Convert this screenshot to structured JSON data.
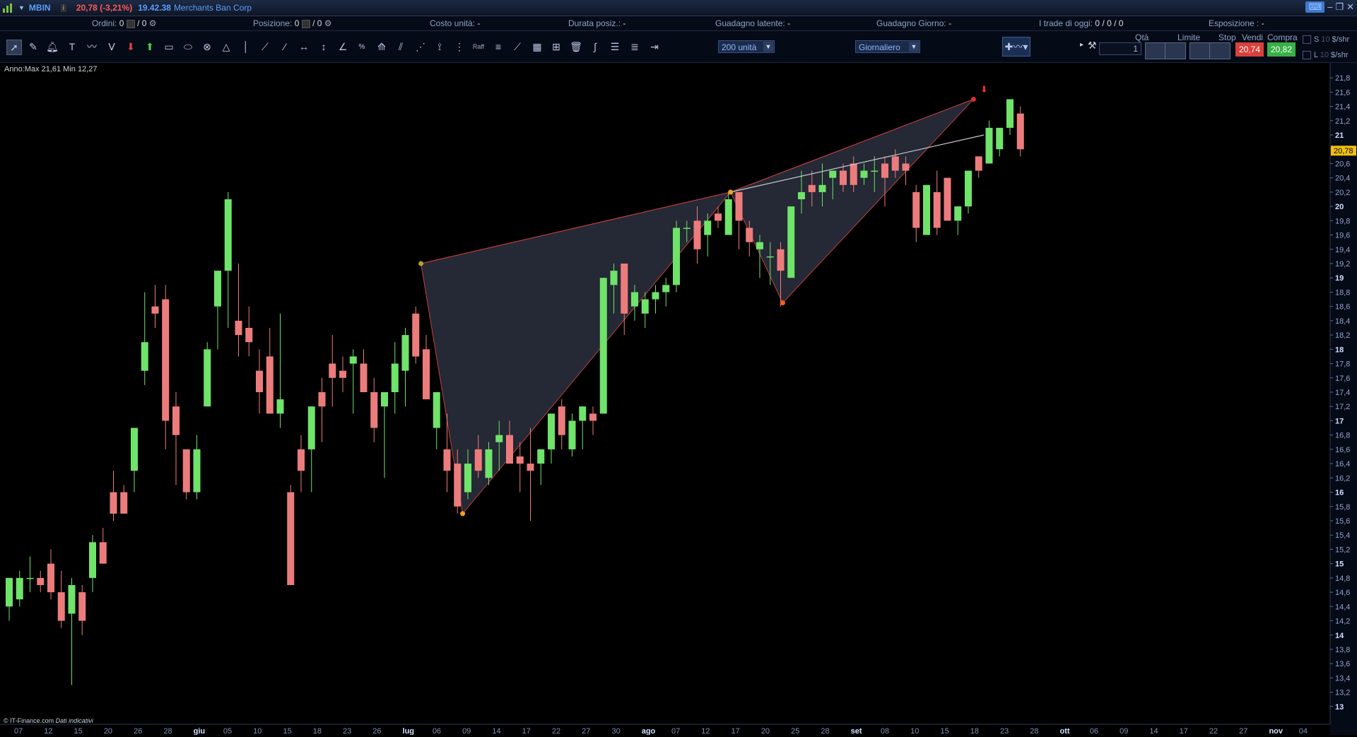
{
  "titlebar": {
    "symbol": "MBIN",
    "price_change": "20,78 (-3,21%)",
    "time": "19.42.38",
    "name": "Merchants Ban Corp"
  },
  "info": {
    "ordini_label": "Ordini:",
    "ordini_value": "0",
    "ordini_value2": "/ 0",
    "posizione_label": "Posizione:",
    "posizione_value": "0",
    "posizione_value2": "/ 0",
    "costo_label": "Costo unità:",
    "costo_value": "-",
    "durata_label": "Durata posiz.:",
    "durata_value": "-",
    "latente_label": "Guadagno latente:",
    "latente_value": "-",
    "giorno_label": "Guadagno Giorno:",
    "giorno_value": "-",
    "trade_label": "I trade di oggi:",
    "trade_value": "0 / 0 / 0",
    "esposizione_label": "Esposizione :",
    "esposizione_value": "-"
  },
  "toolbar": {
    "units_select": "200 unità",
    "period_select": "Giornaliero",
    "raff_label": "Raff"
  },
  "trade": {
    "qta_label": "Qtà",
    "qta_value": "1",
    "limite_label": "Limite",
    "stop_label": "Stop",
    "vendi_label": "Vendi",
    "compra_label": "Compra",
    "vendi_price": "20,74",
    "compra_price": "20,82",
    "s_label": "S",
    "l_label": "L",
    "s_value": "10",
    "l_value": "10",
    "unit_label": "$/shr"
  },
  "annotation": "Anno:Max 21,61 Min 12,27",
  "footer": {
    "source": "© IT-Finance.com",
    "note": "Dati indicativi"
  },
  "colors": {
    "up": "#6fe36a",
    "down": "#ec7c7c",
    "pattern_fill": "#2b2f3e",
    "pattern_line": "#c04040",
    "last_price_bg": "#f0c010"
  },
  "chart_data": {
    "type": "candlestick",
    "ylim": [
      12.9,
      21.9
    ],
    "y_ticks": [
      "21,8",
      "21,6",
      "21,4",
      "21,2",
      "21",
      "20,8",
      "20,6",
      "20,4",
      "20,2",
      "20",
      "19,8",
      "19,6",
      "19,4",
      "19,2",
      "19",
      "18,8",
      "18,6",
      "18,4",
      "18,2",
      "18",
      "17,8",
      "17,6",
      "17,4",
      "17,2",
      "17",
      "16,8",
      "16,6",
      "16,4",
      "16,2",
      "16",
      "15,8",
      "15,6",
      "15,4",
      "15,2",
      "15",
      "14,8",
      "14,6",
      "14,4",
      "14,2",
      "14",
      "13,8",
      "13,6",
      "13,4",
      "13,2",
      "13"
    ],
    "last_price": "20,78",
    "x_labels": [
      "07",
      "12",
      "15",
      "20",
      "26",
      "28",
      "giu",
      "05",
      "10",
      "15",
      "18",
      "23",
      "26",
      "lug",
      "06",
      "09",
      "14",
      "17",
      "22",
      "27",
      "30",
      "ago",
      "07",
      "12",
      "17",
      "20",
      "25",
      "28",
      "set",
      "08",
      "10",
      "15",
      "18",
      "23",
      "28",
      "ott",
      "06",
      "09",
      "14",
      "17",
      "22",
      "27",
      "nov",
      "04"
    ],
    "candles": [
      {
        "o": 14.4,
        "h": 14.8,
        "l": 14.2,
        "c": 14.8
      },
      {
        "o": 14.5,
        "h": 14.9,
        "l": 14.4,
        "c": 14.8
      },
      {
        "o": 14.8,
        "h": 15.1,
        "l": 14.6,
        "c": 14.8
      },
      {
        "o": 14.8,
        "h": 14.9,
        "l": 14.6,
        "c": 14.7
      },
      {
        "o": 15.0,
        "h": 15.2,
        "l": 14.5,
        "c": 14.6
      },
      {
        "o": 14.6,
        "h": 14.9,
        "l": 14.1,
        "c": 14.2
      },
      {
        "o": 14.3,
        "h": 14.8,
        "l": 13.3,
        "c": 14.7
      },
      {
        "o": 14.6,
        "h": 14.7,
        "l": 14.0,
        "c": 14.2
      },
      {
        "o": 14.8,
        "h": 15.4,
        "l": 14.6,
        "c": 15.3
      },
      {
        "o": 15.3,
        "h": 15.5,
        "l": 15.0,
        "c": 15.0
      },
      {
        "o": 16.0,
        "h": 16.3,
        "l": 15.6,
        "c": 15.7
      },
      {
        "o": 16.0,
        "h": 16.1,
        "l": 15.8,
        "c": 15.7
      },
      {
        "o": 16.3,
        "h": 16.9,
        "l": 16.0,
        "c": 16.9
      },
      {
        "o": 17.7,
        "h": 18.8,
        "l": 17.5,
        "c": 18.1
      },
      {
        "o": 18.6,
        "h": 18.9,
        "l": 18.3,
        "c": 18.5
      },
      {
        "o": 18.7,
        "h": 18.9,
        "l": 16.6,
        "c": 17.0
      },
      {
        "o": 17.2,
        "h": 17.4,
        "l": 16.1,
        "c": 16.8
      },
      {
        "o": 16.6,
        "h": 16.4,
        "l": 15.9,
        "c": 16.0
      },
      {
        "o": 16.0,
        "h": 16.8,
        "l": 15.9,
        "c": 16.6
      },
      {
        "o": 17.2,
        "h": 18.1,
        "l": 17.2,
        "c": 18.0
      },
      {
        "o": 18.6,
        "h": 19.0,
        "l": 18.0,
        "c": 19.1
      },
      {
        "o": 19.1,
        "h": 20.2,
        "l": 18.3,
        "c": 20.1
      },
      {
        "o": 18.4,
        "h": 19.2,
        "l": 17.9,
        "c": 18.2
      },
      {
        "o": 18.3,
        "h": 18.6,
        "l": 17.9,
        "c": 18.1
      },
      {
        "o": 17.7,
        "h": 18.0,
        "l": 17.1,
        "c": 17.4
      },
      {
        "o": 17.9,
        "h": 18.3,
        "l": 17.2,
        "c": 17.1
      },
      {
        "o": 17.1,
        "h": 18.5,
        "l": 16.9,
        "c": 17.3
      },
      {
        "o": 16.0,
        "h": 16.1,
        "l": 14.9,
        "c": 14.7
      },
      {
        "o": 16.6,
        "h": 16.8,
        "l": 16.0,
        "c": 16.3
      },
      {
        "o": 16.6,
        "h": 17.2,
        "l": 16.0,
        "c": 17.2
      },
      {
        "o": 17.4,
        "h": 17.6,
        "l": 16.7,
        "c": 17.2
      },
      {
        "o": 17.8,
        "h": 18.2,
        "l": 17.2,
        "c": 17.6
      },
      {
        "o": 17.7,
        "h": 17.9,
        "l": 17.4,
        "c": 17.6
      },
      {
        "o": 17.8,
        "h": 18.0,
        "l": 17.1,
        "c": 17.9
      },
      {
        "o": 17.8,
        "h": 18.0,
        "l": 17.4,
        "c": 17.4
      },
      {
        "o": 17.4,
        "h": 17.6,
        "l": 16.7,
        "c": 16.9
      },
      {
        "o": 17.2,
        "h": 17.4,
        "l": 16.2,
        "c": 17.4
      },
      {
        "o": 17.4,
        "h": 18.1,
        "l": 17.1,
        "c": 17.8
      },
      {
        "o": 17.7,
        "h": 18.3,
        "l": 17.2,
        "c": 18.2
      },
      {
        "o": 18.5,
        "h": 18.6,
        "l": 17.8,
        "c": 17.9
      },
      {
        "o": 18.0,
        "h": 18.2,
        "l": 17.3,
        "c": 17.3
      },
      {
        "o": 16.9,
        "h": 17.4,
        "l": 16.6,
        "c": 17.4
      },
      {
        "o": 16.6,
        "h": 17.1,
        "l": 16.0,
        "c": 16.3
      },
      {
        "o": 16.4,
        "h": 16.6,
        "l": 15.7,
        "c": 15.8
      },
      {
        "o": 16.0,
        "h": 16.6,
        "l": 15.9,
        "c": 16.4
      },
      {
        "o": 16.6,
        "h": 16.8,
        "l": 16.2,
        "c": 16.3
      },
      {
        "o": 16.2,
        "h": 16.7,
        "l": 16.1,
        "c": 16.6
      },
      {
        "o": 16.7,
        "h": 17.0,
        "l": 16.3,
        "c": 16.8
      },
      {
        "o": 16.8,
        "h": 17.0,
        "l": 16.5,
        "c": 16.4
      },
      {
        "o": 16.5,
        "h": 16.7,
        "l": 16.0,
        "c": 16.4
      },
      {
        "o": 16.4,
        "h": 16.9,
        "l": 15.6,
        "c": 16.3
      },
      {
        "o": 16.4,
        "h": 16.6,
        "l": 16.1,
        "c": 16.6
      },
      {
        "o": 16.6,
        "h": 17.1,
        "l": 16.4,
        "c": 17.1
      },
      {
        "o": 17.2,
        "h": 17.3,
        "l": 16.6,
        "c": 16.8
      },
      {
        "o": 16.6,
        "h": 17.1,
        "l": 16.5,
        "c": 17.0
      },
      {
        "o": 17.0,
        "h": 17.2,
        "l": 16.6,
        "c": 17.2
      },
      {
        "o": 17.1,
        "h": 17.2,
        "l": 16.8,
        "c": 17.0
      },
      {
        "o": 17.1,
        "h": 19.0,
        "l": 17.1,
        "c": 19.0
      },
      {
        "o": 18.9,
        "h": 19.2,
        "l": 18.5,
        "c": 19.1
      },
      {
        "o": 19.2,
        "h": 19.2,
        "l": 18.2,
        "c": 18.5
      },
      {
        "o": 18.6,
        "h": 18.9,
        "l": 18.4,
        "c": 18.8
      },
      {
        "o": 18.5,
        "h": 18.8,
        "l": 18.3,
        "c": 18.7
      },
      {
        "o": 18.7,
        "h": 18.9,
        "l": 18.5,
        "c": 18.8
      },
      {
        "o": 18.8,
        "h": 19.0,
        "l": 18.6,
        "c": 18.9
      },
      {
        "o": 18.9,
        "h": 19.8,
        "l": 18.8,
        "c": 19.7
      },
      {
        "o": 19.7,
        "h": 19.8,
        "l": 19.5,
        "c": 19.7
      },
      {
        "o": 19.8,
        "h": 20.0,
        "l": 19.2,
        "c": 19.4
      },
      {
        "o": 19.6,
        "h": 19.9,
        "l": 19.3,
        "c": 19.8
      },
      {
        "o": 19.9,
        "h": 20.0,
        "l": 19.7,
        "c": 19.8
      },
      {
        "o": 19.6,
        "h": 20.2,
        "l": 19.6,
        "c": 20.1
      },
      {
        "o": 20.2,
        "h": 20.2,
        "l": 19.4,
        "c": 19.8
      },
      {
        "o": 19.7,
        "h": 19.8,
        "l": 19.3,
        "c": 19.5
      },
      {
        "o": 19.4,
        "h": 19.6,
        "l": 19.0,
        "c": 19.5
      },
      {
        "o": 19.3,
        "h": 19.5,
        "l": 18.9,
        "c": 19.3
      },
      {
        "o": 19.4,
        "h": 19.5,
        "l": 18.6,
        "c": 19.1
      },
      {
        "o": 19.0,
        "h": 20.0,
        "l": 19.0,
        "c": 20.0
      },
      {
        "o": 20.1,
        "h": 20.5,
        "l": 19.9,
        "c": 20.2
      },
      {
        "o": 20.3,
        "h": 20.5,
        "l": 20.0,
        "c": 20.2
      },
      {
        "o": 20.2,
        "h": 20.6,
        "l": 20.0,
        "c": 20.3
      },
      {
        "o": 20.4,
        "h": 20.5,
        "l": 20.1,
        "c": 20.5
      },
      {
        "o": 20.5,
        "h": 20.6,
        "l": 20.2,
        "c": 20.3
      },
      {
        "o": 20.6,
        "h": 20.7,
        "l": 20.2,
        "c": 20.3
      },
      {
        "o": 20.4,
        "h": 20.6,
        "l": 20.3,
        "c": 20.5
      },
      {
        "o": 20.5,
        "h": 20.7,
        "l": 20.2,
        "c": 20.5
      },
      {
        "o": 20.6,
        "h": 20.7,
        "l": 20.0,
        "c": 20.4
      },
      {
        "o": 20.7,
        "h": 20.8,
        "l": 20.4,
        "c": 20.5
      },
      {
        "o": 20.6,
        "h": 20.7,
        "l": 20.3,
        "c": 20.5
      },
      {
        "o": 20.2,
        "h": 20.3,
        "l": 19.5,
        "c": 19.7
      },
      {
        "o": 19.6,
        "h": 20.3,
        "l": 19.6,
        "c": 20.3
      },
      {
        "o": 20.2,
        "h": 20.5,
        "l": 19.6,
        "c": 19.7
      },
      {
        "o": 20.4,
        "h": 20.4,
        "l": 19.8,
        "c": 19.8
      },
      {
        "o": 19.8,
        "h": 20.0,
        "l": 19.6,
        "c": 20.0
      },
      {
        "o": 20.0,
        "h": 20.5,
        "l": 19.9,
        "c": 20.5
      },
      {
        "o": 20.7,
        "h": 20.7,
        "l": 20.4,
        "c": 20.5
      },
      {
        "o": 20.6,
        "h": 21.2,
        "l": 20.6,
        "c": 21.1
      },
      {
        "o": 20.8,
        "h": 21.1,
        "l": 20.7,
        "c": 21.1
      },
      {
        "o": 21.1,
        "h": 21.5,
        "l": 21.0,
        "c": 21.5
      },
      {
        "o": 21.3,
        "h": 21.4,
        "l": 20.7,
        "c": 20.8
      }
    ],
    "pattern": {
      "points": [
        {
          "i": 39.5,
          "p": 19.2,
          "color": "#b8a030"
        },
        {
          "i": 43.5,
          "p": 15.7,
          "color": "#f0a020"
        },
        {
          "i": 69.2,
          "p": 20.2,
          "color": "#f0a020"
        },
        {
          "i": 74.2,
          "p": 18.65,
          "color": "#f06020"
        },
        {
          "i": 92.5,
          "p": 21.5,
          "color": "#e03030"
        }
      ],
      "trend_line": [
        {
          "i": 69.2,
          "p": 20.2
        },
        {
          "i": 93.5,
          "p": 21.0
        }
      ]
    }
  }
}
